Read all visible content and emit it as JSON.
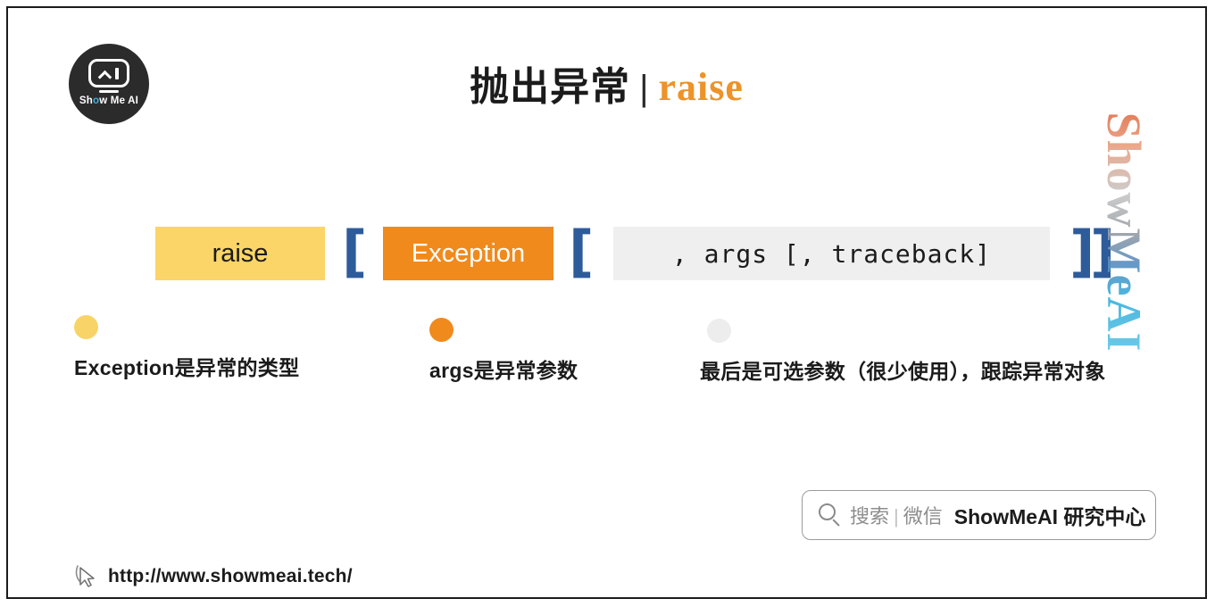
{
  "slide": {
    "title_cn": "抛出异常",
    "title_separator": "|",
    "title_en": "raise"
  },
  "logo": {
    "wordmark_before": "Sh",
    "wordmark_o": "o",
    "wordmark_after": "w Me AI"
  },
  "syntax": {
    "keyword_box": "raise",
    "exception_box": "Exception",
    "args_box": ", args [, traceback]",
    "bracket_open_1": "[",
    "bracket_open_2": "[",
    "bracket_close_1": "]",
    "bracket_close_2": "]"
  },
  "annotations": [
    {
      "dot_color": "#F8D468",
      "label": "Exception是异常的类型"
    },
    {
      "dot_color": "#F08A1C",
      "label": "args是异常参数"
    },
    {
      "dot_color": "#EDEDED",
      "label": "最后是可选参数（很少使用），跟踪异常对象"
    }
  ],
  "watermark": {
    "text": "ShowMeAI"
  },
  "wechat": {
    "search_label": "搜索",
    "divider": "|",
    "channel_label": "微信",
    "account_name": "ShowMeAI 研究中心"
  },
  "footer": {
    "url": "http://www.showmeai.tech/"
  },
  "colors": {
    "accent_orange": "#ED9328",
    "box_yellow": "#FBD567",
    "box_orange": "#F08A1C",
    "box_gray": "#EFEFEF",
    "bracket_blue": "#2E5B99",
    "frame": "#1b1b1b"
  }
}
